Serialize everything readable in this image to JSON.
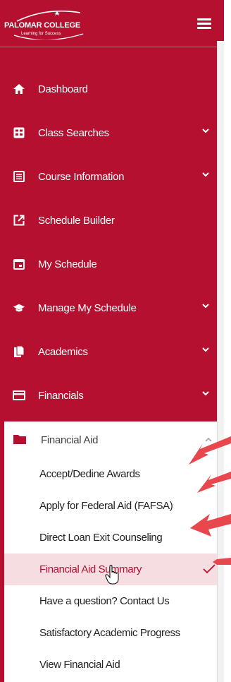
{
  "brand": {
    "name": "PALOMAR COLLEGE",
    "tagline": "Learning for Success"
  },
  "nav": {
    "items": [
      {
        "label": "Dashboard",
        "icon": "home-icon",
        "expandable": false
      },
      {
        "label": "Class Searches",
        "icon": "class-search-icon",
        "expandable": true
      },
      {
        "label": "Course Information",
        "icon": "list-icon",
        "expandable": true
      },
      {
        "label": "Schedule Builder",
        "icon": "external-link-icon",
        "expandable": false
      },
      {
        "label": "My Schedule",
        "icon": "calendar-icon",
        "expandable": false
      },
      {
        "label": "Manage My Schedule",
        "icon": "graduation-cap-icon",
        "expandable": true
      },
      {
        "label": "Academics",
        "icon": "documents-icon",
        "expandable": true
      },
      {
        "label": "Financials",
        "icon": "credit-card-icon",
        "expandable": true
      }
    ]
  },
  "financial_aid": {
    "label": "Financial Aid",
    "items": [
      {
        "label": "Accept/Dedine Awards"
      },
      {
        "label": "Apply for Federal Aid (FAFSA)"
      },
      {
        "label": "Direct Loan Exit Counseling"
      },
      {
        "label": "Financial Aid Summary",
        "active": true
      },
      {
        "label": "Have a question? Contact Us"
      },
      {
        "label": "Satisfactory Academic Progress"
      },
      {
        "label": "View Financial Aid"
      }
    ]
  },
  "colors": {
    "brand_red": "#b5102f",
    "active_bg": "#f5dde2",
    "annotation_arrow": "#e8484d"
  }
}
